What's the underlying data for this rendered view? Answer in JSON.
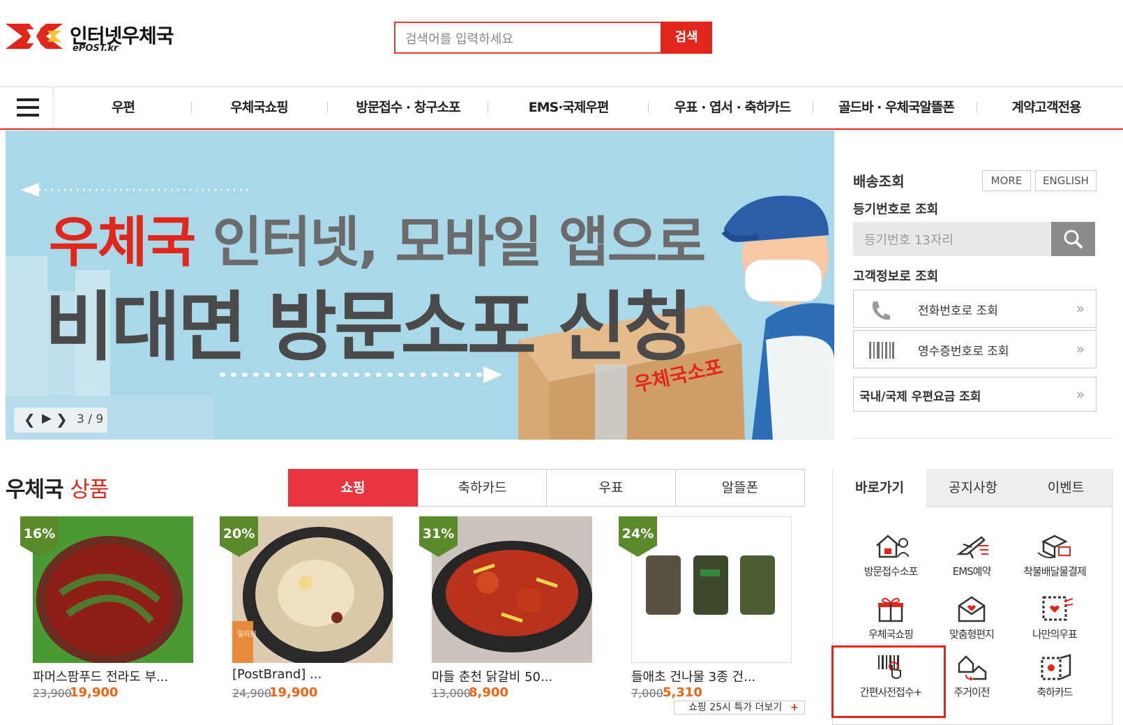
{
  "header": {
    "logo_text": "인터넷우체국",
    "logo_sub": "ePOST.kr",
    "search_placeholder": "검색어를 입력하세요",
    "search_button": "검색"
  },
  "gnb": [
    "우편",
    "우체국쇼핑",
    "방문접수 · 창구소포",
    "EMS·국제우편",
    "우표 · 엽서 · 축하카드",
    "골드바 · 우체국알뜰폰",
    "계약고객전용"
  ],
  "banner": {
    "line1_red": "우체국",
    "line1_gray": "인터넷, 모바일 앱으로",
    "line2": "비대면 방문소포 신청",
    "box_text": "우체국소포",
    "slide_counter": "3 / 9"
  },
  "delivery": {
    "title": "배송조회",
    "more_button": "MORE",
    "english_button": "ENGLISH",
    "reg_label": "등기번호로 조회",
    "reg_placeholder": "등기번호 13자리",
    "customer_label": "고객정보로 조회",
    "phone_lookup": "전화번호로 조회",
    "receipt_lookup": "영수증번호로 조회",
    "postage_lookup": "국내/국제 우편요금 조회"
  },
  "products": {
    "title_black": "우체국",
    "title_red": "상품",
    "tabs": [
      "쇼핑",
      "축하카드",
      "우표",
      "알뜰폰"
    ],
    "items": [
      {
        "badge": "16%",
        "name": "파머스팜푸드 전라도 부...",
        "old_price": "23,900",
        "price": "19,900"
      },
      {
        "badge": "20%",
        "name": "[PostBrand] ...",
        "old_price": "24,900",
        "price": "19,900"
      },
      {
        "badge": "31%",
        "name": "마들 춘천 닭갈비 50...",
        "old_price": "13,000",
        "price": "8,900"
      },
      {
        "badge": "24%",
        "name": "들애초 건나물 3종 건...",
        "old_price": "7,000",
        "price": "5,310"
      }
    ],
    "more_link": "쇼핑 25시 특가 더보기",
    "more_plus": "+",
    "brand_tag": "밀리원"
  },
  "quick": {
    "tabs": [
      "바로가기",
      "공지사항",
      "이벤트"
    ],
    "items": [
      "방문접수소포",
      "EMS예약",
      "착불배달물결제",
      "우체국쇼핑",
      "맞춤형편지",
      "나만의우표",
      "간편사전접수+",
      "주거이전",
      "축하카드"
    ]
  },
  "colors": {
    "brand_red": "#e1261c",
    "price_orange": "#f06414",
    "badge_green": "#5b8a2a",
    "banner_bg": "#a9d8e8"
  }
}
